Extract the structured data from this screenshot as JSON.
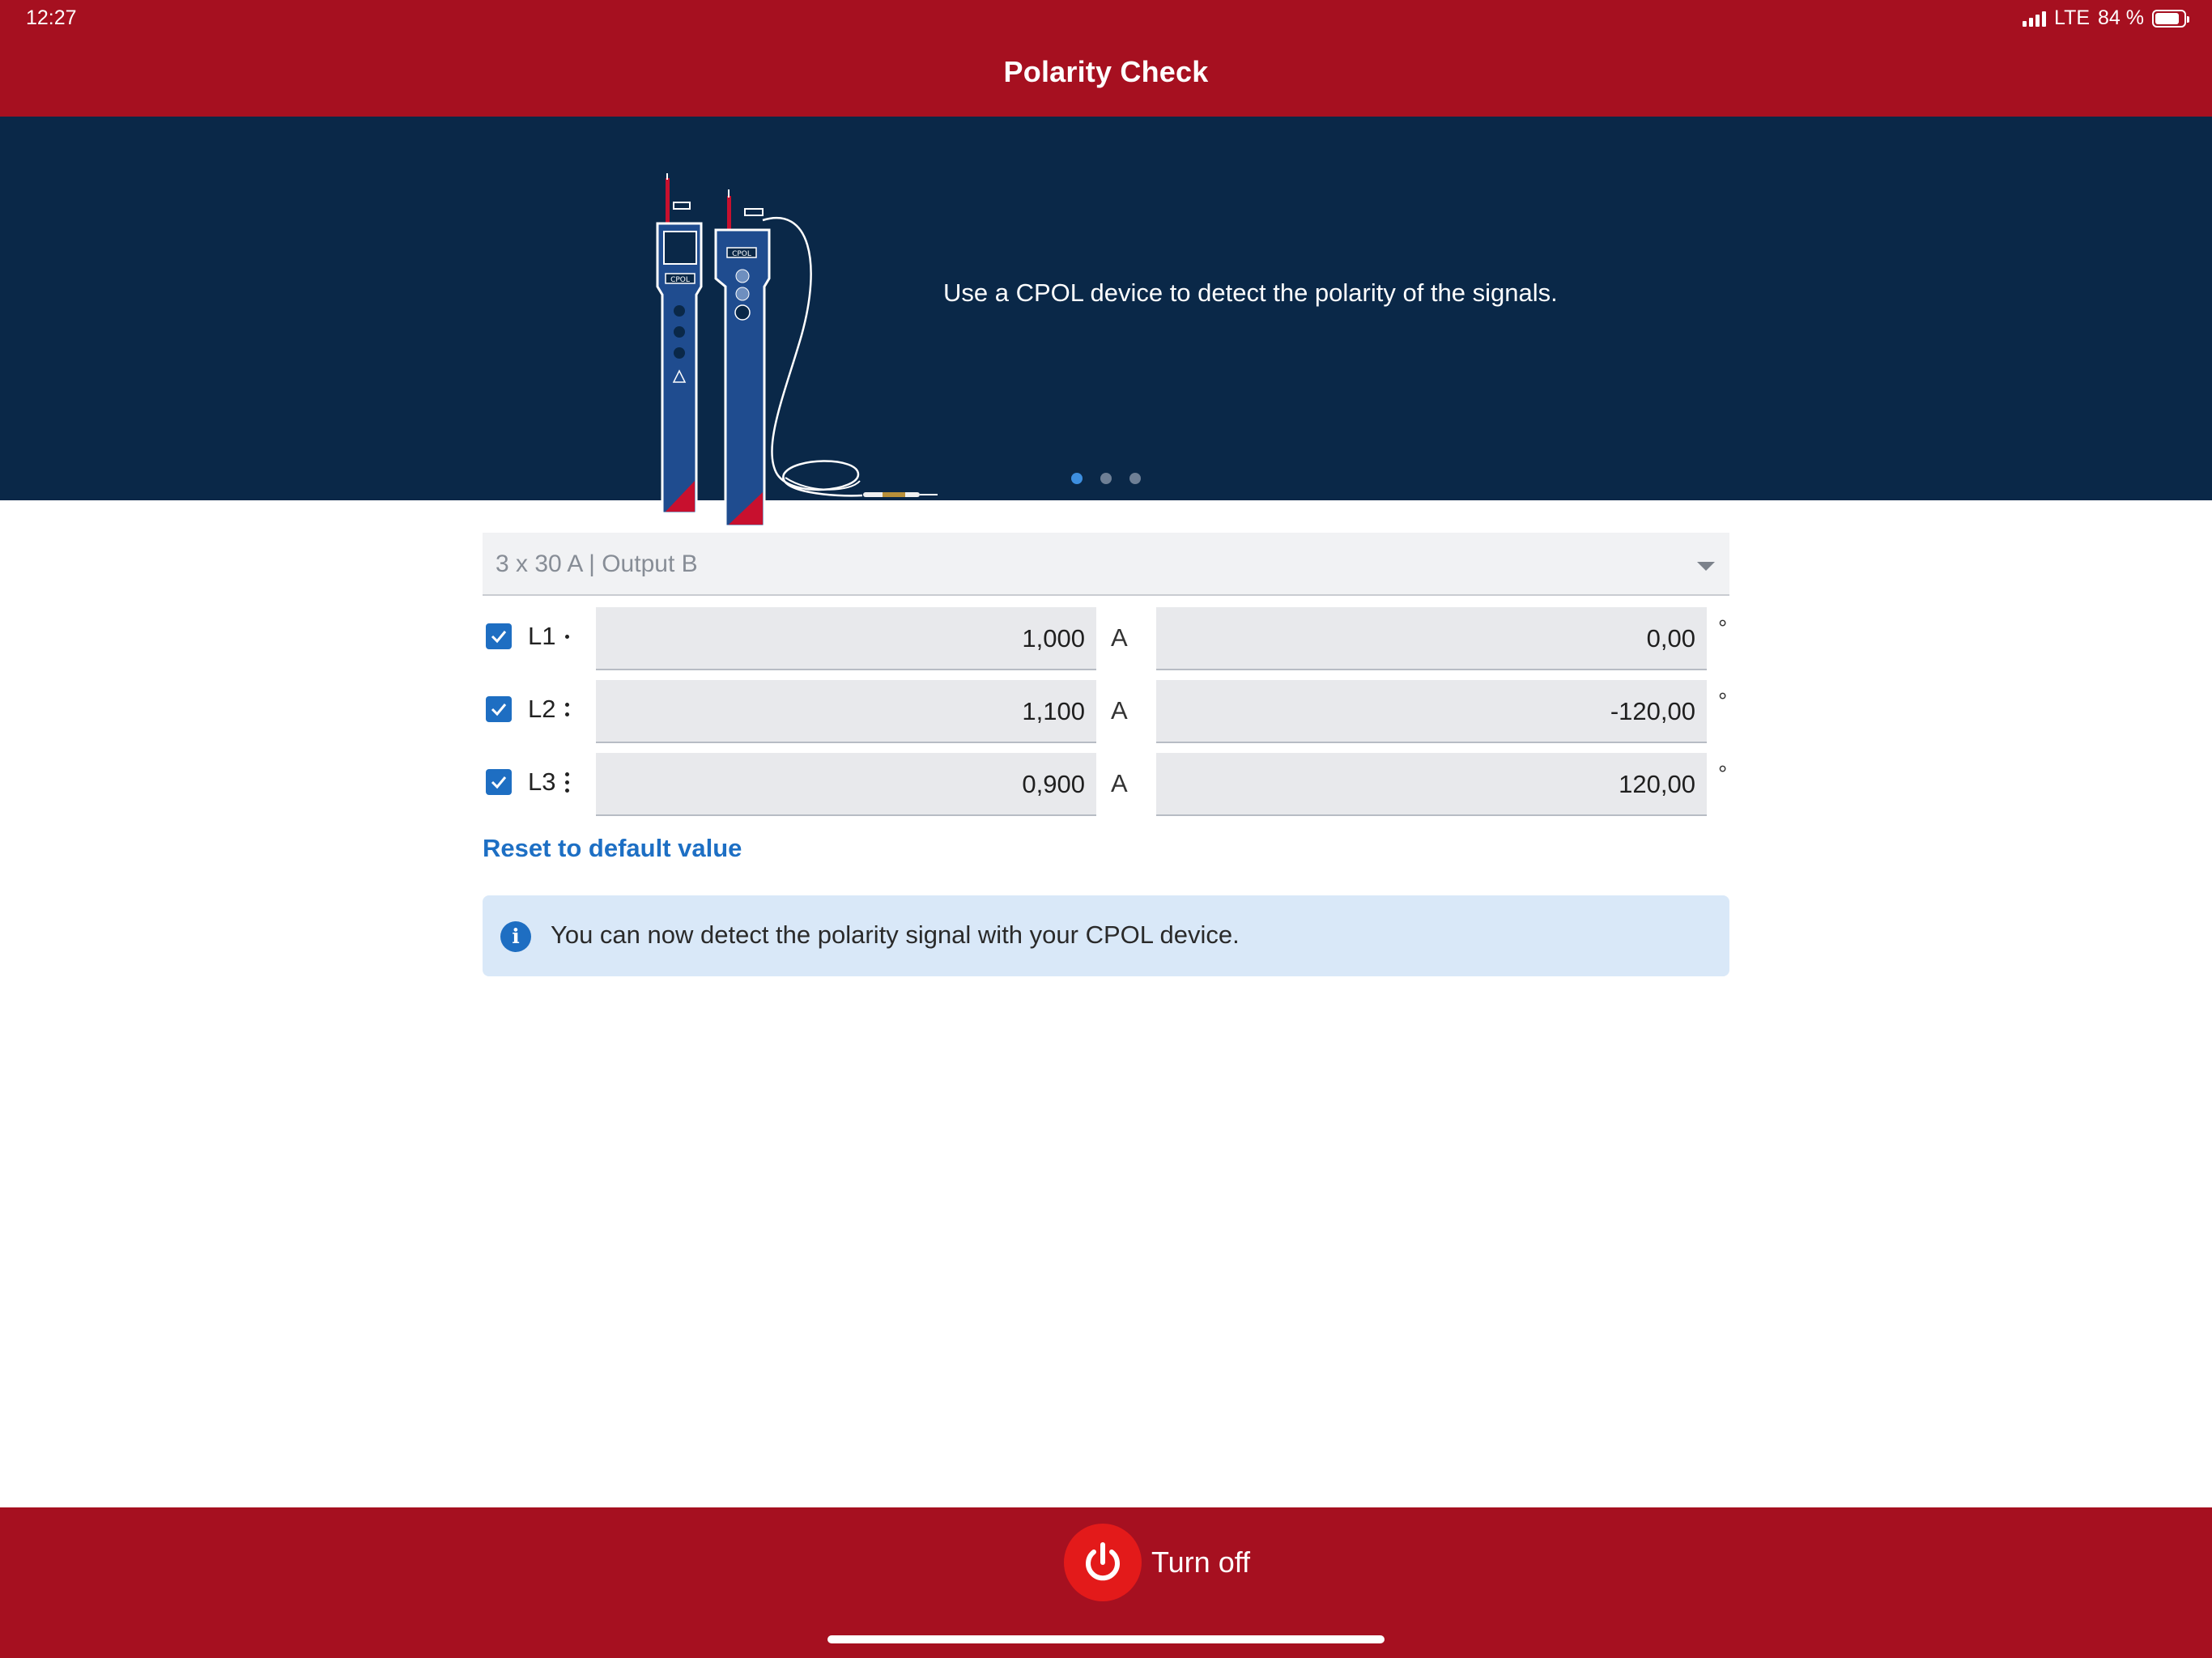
{
  "status_bar": {
    "time": "12:27",
    "network": "LTE",
    "battery": "84 %",
    "battery_level": 0.84
  },
  "header": {
    "title": "Polarity Check"
  },
  "banner": {
    "text": "Use a CPOL device to detect the polarity of the signals.",
    "illustration_labels": [
      "CPOL",
      "CPOL"
    ],
    "pages": 3,
    "active_page": 1
  },
  "output_select": {
    "value": "3 x 30 A | Output B"
  },
  "phases": [
    {
      "label": "L1",
      "checked": true,
      "current": "1,000",
      "current_unit": "A",
      "angle": "0,00",
      "angle_unit": "°"
    },
    {
      "label": "L2",
      "checked": true,
      "current": "1,100",
      "current_unit": "A",
      "angle": "-120,00",
      "angle_unit": "°"
    },
    {
      "label": "L3",
      "checked": true,
      "current": "0,900",
      "current_unit": "A",
      "angle": "120,00",
      "angle_unit": "°"
    }
  ],
  "reset_link": "Reset to default value",
  "info": {
    "icon": "info-icon",
    "text": "You can now detect the polarity signal with your CPOL device."
  },
  "footer": {
    "turn_off_label": "Turn off",
    "icon": "power-icon"
  },
  "colors": {
    "header_red": "#a61020",
    "banner_navy": "#0a2848",
    "accent_blue": "#1e6ec2",
    "power_red": "#e31a1a",
    "info_bg": "#d9e8f8"
  }
}
